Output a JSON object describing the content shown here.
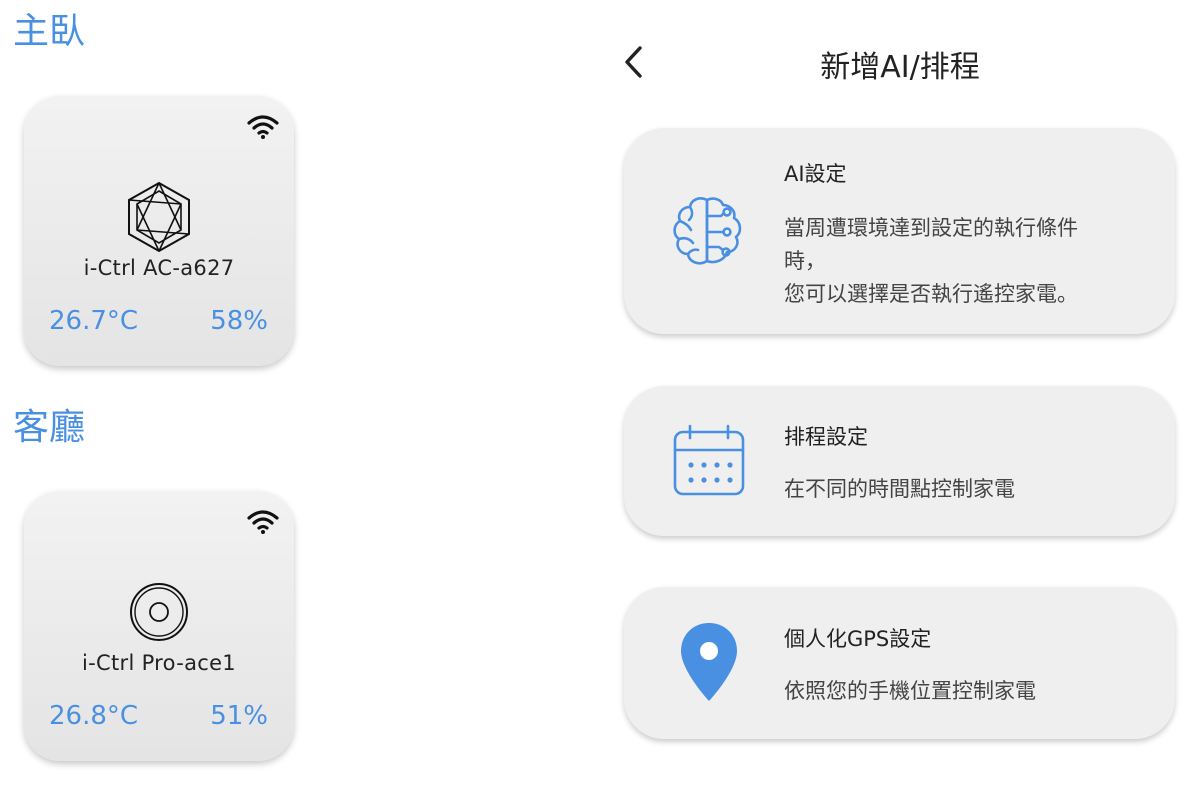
{
  "rooms": [
    {
      "name": "主臥",
      "device": {
        "name": "i-Ctrl AC-a627",
        "temperature": "26.7°C",
        "humidity": "58%",
        "icon": "hexagon-device-icon"
      }
    },
    {
      "name": "客廳",
      "device": {
        "name": "i-Ctrl Pro-ace1",
        "temperature": "26.8°C",
        "humidity": "51%",
        "icon": "round-device-icon"
      }
    }
  ],
  "header": {
    "title": "新增AI/排程",
    "back_icon": "chevron-left-icon"
  },
  "options": [
    {
      "title": "AI設定",
      "desc_lines": [
        "當周遭環境達到設定的執行條件",
        "時，",
        "您可以選擇是否執行遙控家電。"
      ],
      "icon": "brain-icon"
    },
    {
      "title": "排程設定",
      "desc_lines": [
        "在不同的時間點控制家電"
      ],
      "icon": "calendar-icon"
    },
    {
      "title": "個人化GPS設定",
      "desc_lines": [
        "依照您的手機位置控制家電"
      ],
      "icon": "location-pin-icon"
    }
  ],
  "colors": {
    "accent": "#4a90e2",
    "card_bg": "#efefef",
    "text": "#222222"
  }
}
